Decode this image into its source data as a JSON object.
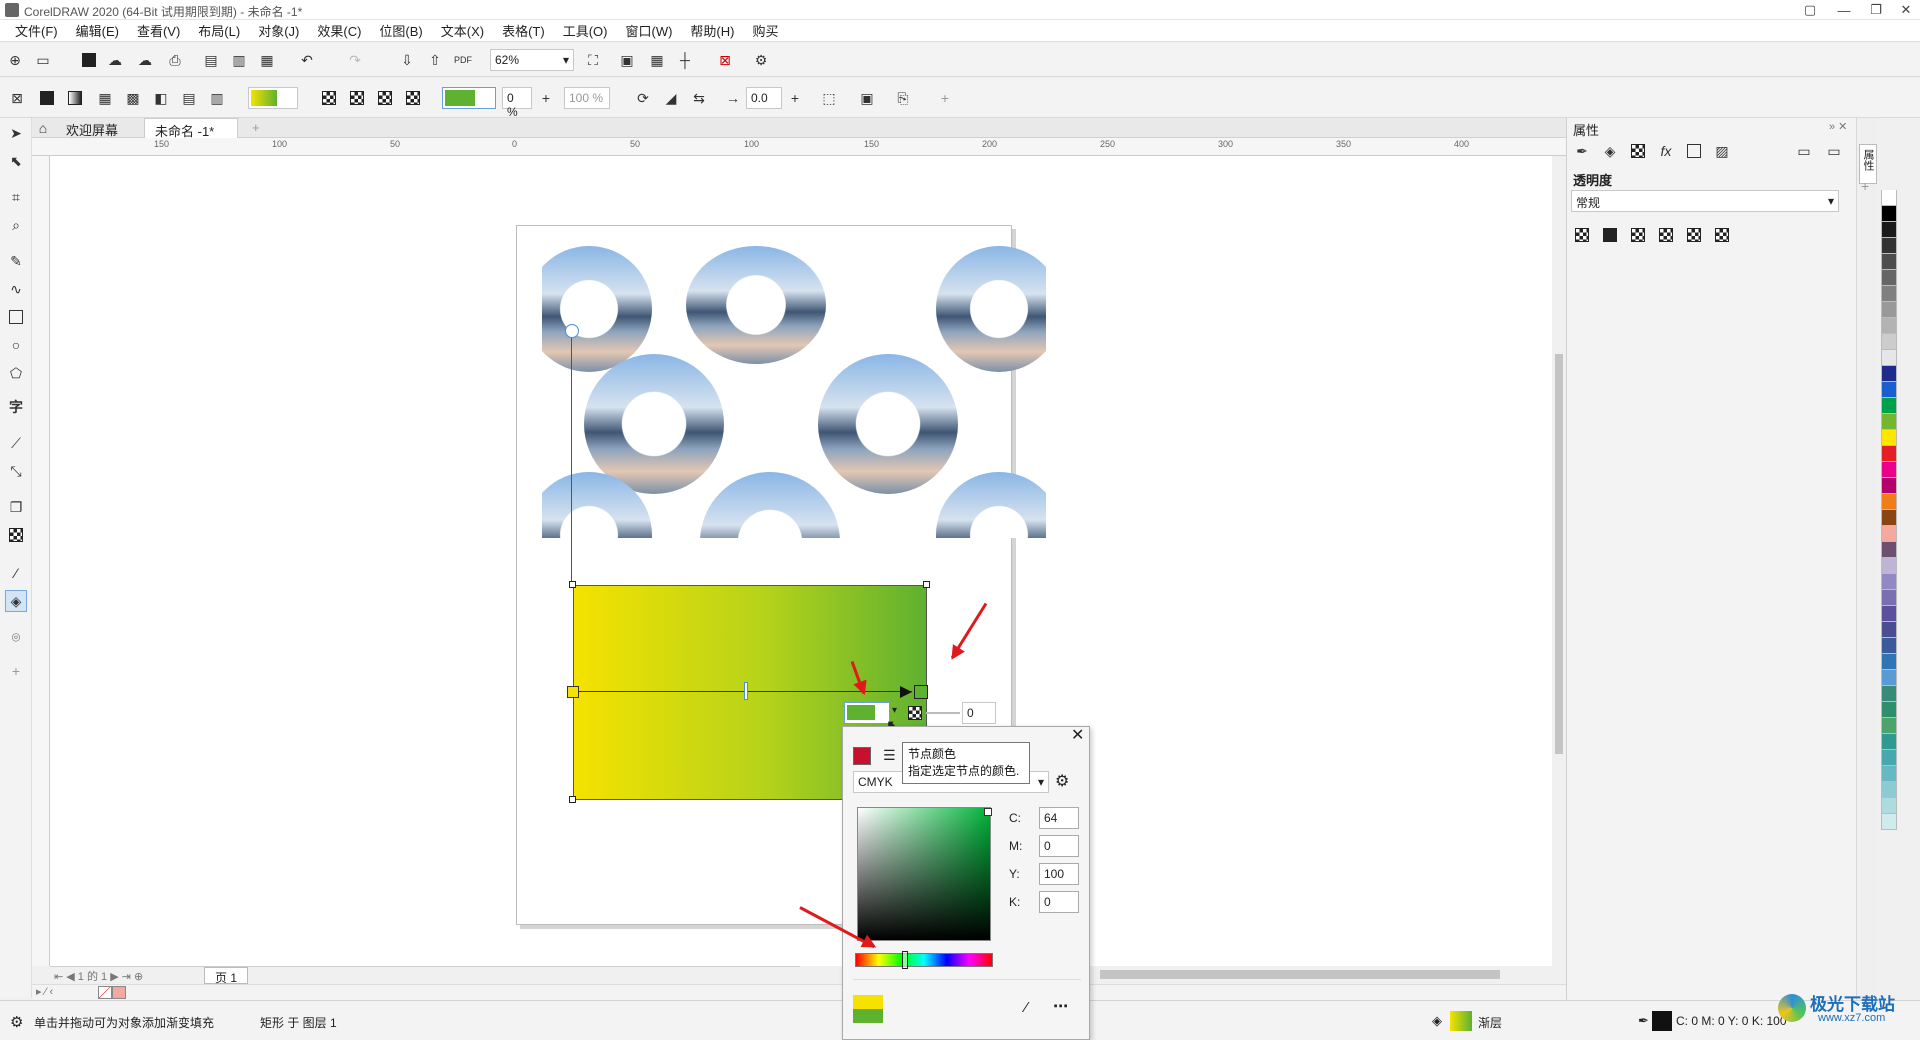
{
  "window": {
    "title": "CorelDRAW 2020 (64-Bit 试用期限到期) - 未命名 -1*"
  },
  "menu": [
    "文件(F)",
    "编辑(E)",
    "查看(V)",
    "布局(L)",
    "对象(J)",
    "效果(C)",
    "位图(B)",
    "文本(X)",
    "表格(T)",
    "工具(O)",
    "窗口(W)",
    "帮助(H)",
    "购买"
  ],
  "toolbar": {
    "zoom": "62%",
    "transparency": "0 %",
    "transparency2": "100 %",
    "angle": "0.0"
  },
  "tabs": {
    "welcome": "欢迎屏幕",
    "doc": "未命名 -1*"
  },
  "ruler": {
    "h": [
      "150",
      "100",
      "50",
      "0",
      "50",
      "100",
      "150",
      "200",
      "250",
      "300",
      "350",
      "400"
    ]
  },
  "node_edit": {
    "value": "0"
  },
  "tooltip": {
    "title": "节点颜色",
    "desc": "指定选定节点的颜色."
  },
  "picker": {
    "model": "CMYK",
    "c_label": "C:",
    "c": "64",
    "m_label": "M:",
    "m": "0",
    "y_label": "Y:",
    "y": "100",
    "k_label": "K:",
    "k": "0"
  },
  "pagebar": {
    "page": "页 1",
    "nav": "1 的 1"
  },
  "panel": {
    "title": "属性",
    "section": "透明度",
    "mode": "常规",
    "side_label": "属性"
  },
  "status": {
    "hint": "单击并拖动可为对象添加渐变填充",
    "object": "矩形 于 图层 1",
    "fill_type": "渐层",
    "outline": "C: 0 M: 0 Y: 0 K: 100"
  },
  "watermark": {
    "text": "极光下载站",
    "url": "www.xz7.com"
  },
  "colors": {
    "accent": "#5fb130",
    "gradient_start": "#f5e200",
    "gradient_end": "#5fb130",
    "arrow": "#e01a1a"
  },
  "palette": [
    "#ffffff",
    "#000000",
    "#1a1a1a",
    "#333333",
    "#4d4d4d",
    "#666666",
    "#808080",
    "#999999",
    "#b3b3b3",
    "#cccccc",
    "#e6e6e6",
    "#1e2a8c",
    "#1a5fd0",
    "#00a14b",
    "#74b72e",
    "#ffe600",
    "#e31e24",
    "#ec008c",
    "#b3006a",
    "#f07d1a",
    "#8b4513",
    "#f4a8a0",
    "#6d4f6e",
    "#bfb4d6",
    "#9188c4",
    "#7a6fb1",
    "#5b4f9e",
    "#4a4d8f",
    "#3b5a9a",
    "#2f74b5",
    "#5a9bd5",
    "#3a8a7a",
    "#2e8f6f",
    "#4ba56b",
    "#2f9a8f",
    "#47a8b0",
    "#66b8c4",
    "#8ccbd1",
    "#aedbe0",
    "#d0ebee"
  ]
}
